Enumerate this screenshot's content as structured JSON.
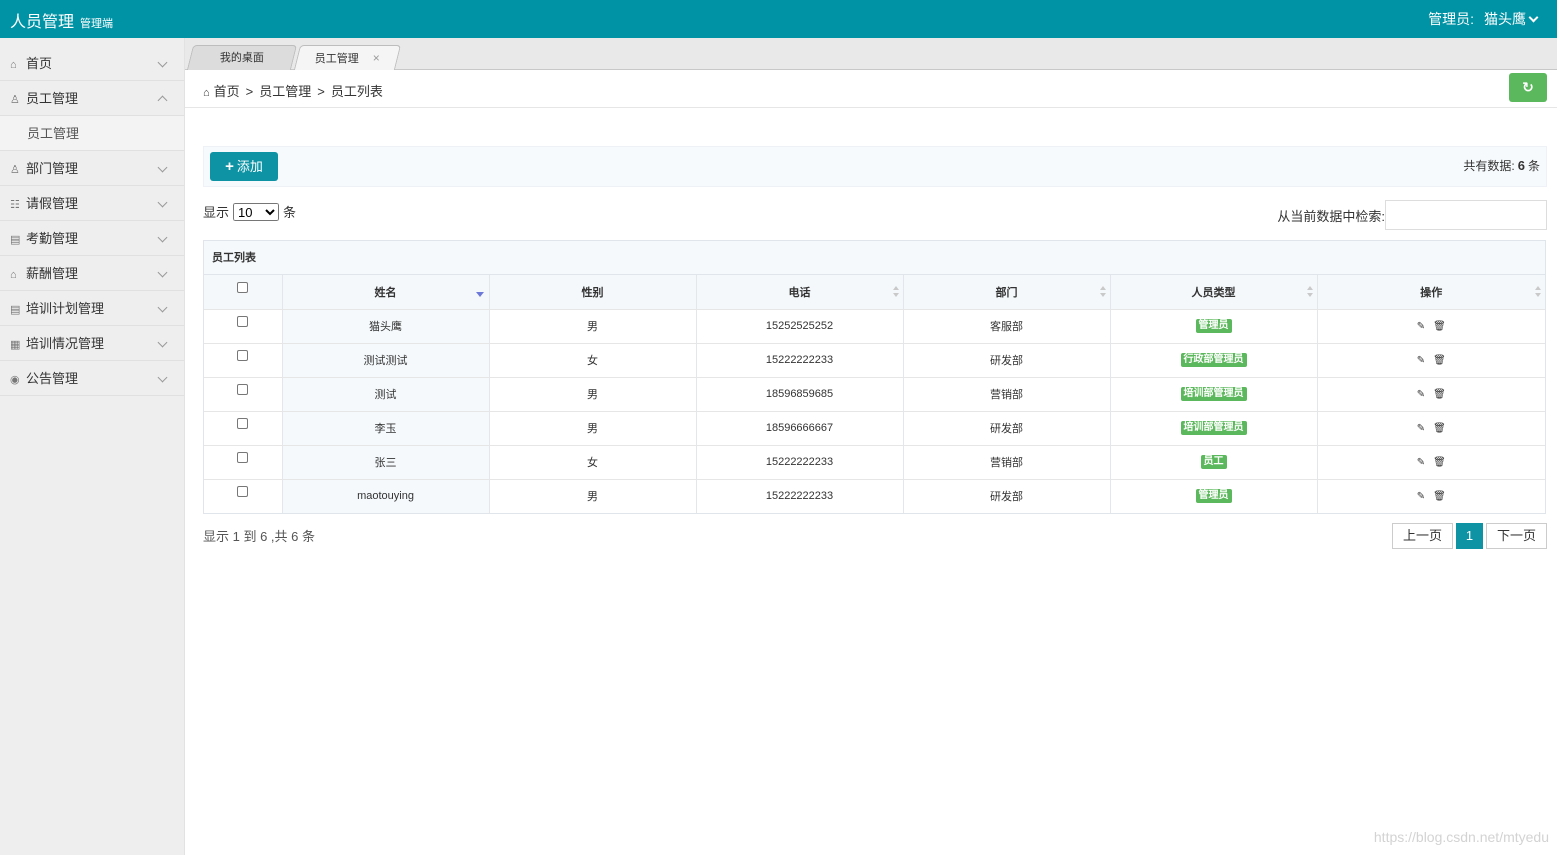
{
  "header": {
    "app_title": "人员管理",
    "subtitle": "管理端",
    "user_label": "管理员:",
    "user_name": "猫头鹰"
  },
  "sidebar": {
    "items": [
      {
        "label": "首页",
        "icon": "home-icon",
        "glyph": "⌂"
      },
      {
        "label": "员工管理",
        "icon": "user-icon",
        "glyph": "♙",
        "expanded": true,
        "children": [
          "员工管理"
        ]
      },
      {
        "label": "部门管理",
        "icon": "users-icon",
        "glyph": "♙"
      },
      {
        "label": "请假管理",
        "icon": "list-icon",
        "glyph": "☷"
      },
      {
        "label": "考勤管理",
        "icon": "clipboard-icon",
        "glyph": "▤"
      },
      {
        "label": "薪酬管理",
        "icon": "bank-icon",
        "glyph": "⌂"
      },
      {
        "label": "培训计划管理",
        "icon": "file-icon",
        "glyph": "▤"
      },
      {
        "label": "培训情况管理",
        "icon": "database-icon",
        "glyph": "▦"
      },
      {
        "label": "公告管理",
        "icon": "eye-icon",
        "glyph": "◉"
      }
    ]
  },
  "tabs": [
    {
      "label": "我的桌面"
    },
    {
      "label": "员工管理",
      "close": "×"
    }
  ],
  "breadcrumb": {
    "home": "首页",
    "sep": ">",
    "level1": "员工管理",
    "level2": "员工列表"
  },
  "toolbar": {
    "add_label": "添加",
    "total_prefix": "共有数据:",
    "total_count": "6",
    "total_suffix": "条"
  },
  "length_menu": {
    "prefix": "显示",
    "value": "10",
    "suffix": "条"
  },
  "search": {
    "label": "从当前数据中检索:",
    "value": ""
  },
  "table": {
    "caption": "员工列表",
    "columns": [
      "姓名",
      "性别",
      "电话",
      "部门",
      "人员类型",
      "操作"
    ],
    "rows": [
      {
        "name": "猫头鹰",
        "gender": "男",
        "phone": "15252525252",
        "dept": "客服部",
        "type": "管理员"
      },
      {
        "name": "测试测试",
        "gender": "女",
        "phone": "15222222233",
        "dept": "研发部",
        "type": "行政部管理员"
      },
      {
        "name": "测试",
        "gender": "男",
        "phone": "18596859685",
        "dept": "营销部",
        "type": "培训部管理员"
      },
      {
        "name": "李玉",
        "gender": "男",
        "phone": "18596666667",
        "dept": "研发部",
        "type": "培训部管理员"
      },
      {
        "name": "张三",
        "gender": "女",
        "phone": "15222222233",
        "dept": "营销部",
        "type": "员工"
      },
      {
        "name": "maotouying",
        "gender": "男",
        "phone": "15222222233",
        "dept": "研发部",
        "type": "管理员"
      }
    ]
  },
  "footer": {
    "info": "显示 1 到 6 ,共 6 条",
    "prev": "上一页",
    "page": "1",
    "next": "下一页"
  },
  "colors": {
    "primary": "#0093a5",
    "badge_green": "#5cb85c",
    "sort_active": "#6d79d8"
  },
  "watermark": "https://blog.csdn.net/mtyedu"
}
